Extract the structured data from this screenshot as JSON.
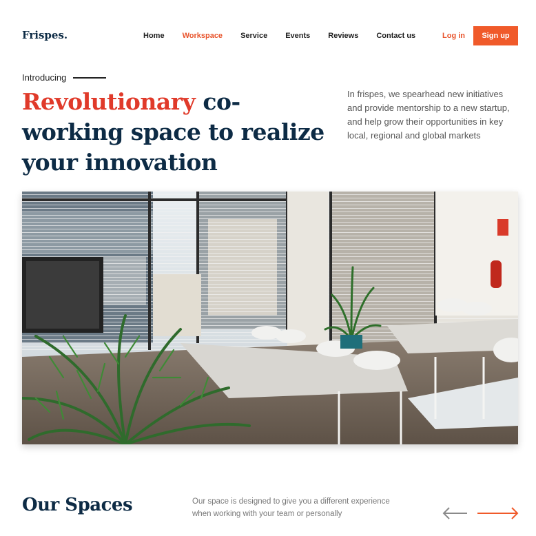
{
  "brand": {
    "logo": "Frispes."
  },
  "nav": {
    "items": [
      {
        "label": "Home"
      },
      {
        "label": "Workspace"
      },
      {
        "label": "Service"
      },
      {
        "label": "Events"
      },
      {
        "label": "Reviews"
      },
      {
        "label": "Contact us"
      }
    ],
    "active": "Workspace"
  },
  "auth": {
    "login_label": "Log in",
    "signup_label": "Sign up"
  },
  "hero": {
    "intro": "Introducing",
    "headline_accent": "Revolutionary",
    "headline_rest": " co-working space to realize your innovation",
    "description": "In frispes, we spearhead new initiatives and provide mentorship to a new startup, and help grow their opportunities in key local, regional and global markets"
  },
  "spaces": {
    "title": "Our Spaces",
    "description": "Our space is designed to give you a different experience when working with your team or personally"
  },
  "colors": {
    "accent": "#f05a2a",
    "headline_accent": "#e03a2a",
    "navy": "#0d2b45"
  },
  "icons": {
    "prev": "arrow-left-icon",
    "next": "arrow-right-icon"
  }
}
